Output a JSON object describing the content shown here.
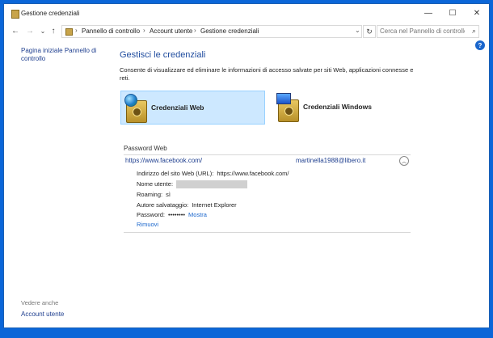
{
  "window": {
    "title": "Gestione credenziali"
  },
  "controls": {
    "minimize": "—",
    "maximize": "☐",
    "close": "✕"
  },
  "nav": {
    "back": "←",
    "forward": "→",
    "recent": "⌄",
    "up": "↑"
  },
  "breadcrumb": {
    "items": [
      "Pannello di controllo",
      "Account utente",
      "Gestione credenziali"
    ],
    "separator": "›",
    "dropdown": "⌄"
  },
  "refresh": "↻",
  "search": {
    "placeholder": "Cerca nel Pannello di controllo",
    "icon": "⌕"
  },
  "help": "?",
  "sidebar": {
    "home_link": "Pagina iniziale Pannello di controllo",
    "see_also": "Vedere anche",
    "account_link": "Account utente"
  },
  "main": {
    "title": "Gestisci le credenziali",
    "description": "Consente di visualizzare ed eliminare le informazioni di accesso salvate per siti Web, applicazioni connesse e reti."
  },
  "tiles": {
    "web": "Credenziali Web",
    "windows": "Credenziali Windows"
  },
  "section": {
    "label": "Password Web"
  },
  "credential": {
    "url": "https://www.facebook.com/",
    "user": "martinella1988@libero.it",
    "collapse_icon": "︿",
    "site_label": "Indirizzo del sito Web (URL):",
    "site_value": "https://www.facebook.com/",
    "username_label": "Nome utente:",
    "roaming_label": "Roaming:",
    "roaming_value": "sì",
    "saved_by_label": "Autore salvataggio:",
    "saved_by_value": "Internet Explorer",
    "password_label": "Password:",
    "password_value": "••••••••",
    "show_link": "Mostra",
    "remove_link": "Rimuovi"
  }
}
